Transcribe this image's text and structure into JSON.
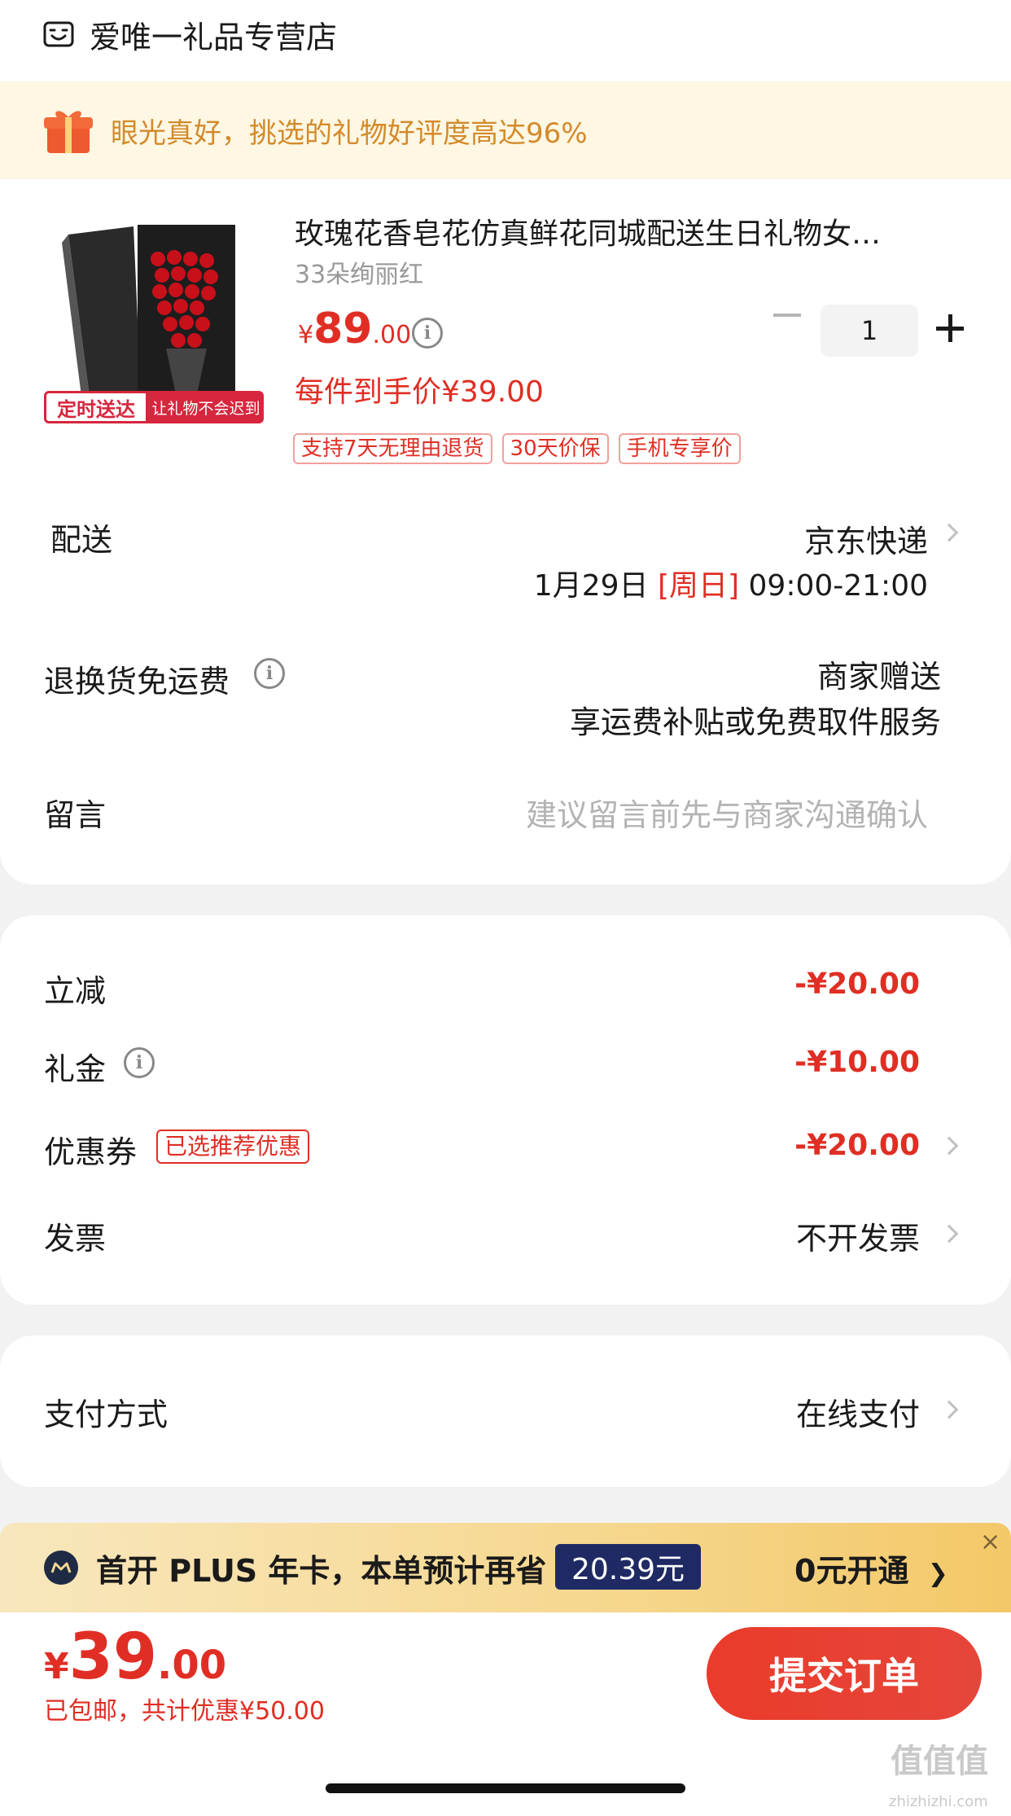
{
  "store": {
    "name": "爱唯一礼品专营店"
  },
  "gift_banner": {
    "text": "眼光真好，挑选的礼物好评度高达96%"
  },
  "product": {
    "image_badge": "定时送达",
    "image_badge_sub": "让礼物不会迟到",
    "title": "玫瑰花香皂花仿真鲜花同城配送生日礼物女…",
    "spec": "33朵绚丽红",
    "price_symbol": "¥",
    "price_int": "89",
    "price_dec": ".00",
    "quantity": "1",
    "hand_price": "每件到手价¥39.00",
    "tags": [
      "支持7天无理由退货",
      "30天价保",
      "手机专享价"
    ]
  },
  "delivery": {
    "label": "配送",
    "carrier": "京东快递",
    "date": "1月29日",
    "weekday": "[周日]",
    "time": "09:00-21:00"
  },
  "return_shipping": {
    "label": "退换货免运费",
    "value": "商家赠送",
    "desc": "享运费补贴或免费取件服务"
  },
  "message": {
    "label": "留言",
    "placeholder": "建议留言前先与商家沟通确认"
  },
  "discounts": {
    "instant": {
      "label": "立减",
      "value": "-¥20.00"
    },
    "gift_money": {
      "label": "礼金",
      "value": "-¥10.00"
    },
    "coupon": {
      "label": "优惠券",
      "tag": "已选推荐优惠",
      "value": "-¥20.00"
    },
    "invoice": {
      "label": "发票",
      "value": "不开发票"
    }
  },
  "payment": {
    "label": "支付方式",
    "value": "在线支付"
  },
  "plus_banner": {
    "text": "首开 PLUS 年卡，本单预计再省",
    "amount": "20.39元",
    "action": "0元开通",
    "close": "×"
  },
  "bottom": {
    "total_symbol": "¥",
    "total_int": "39",
    "total_dec": ".00",
    "sub": "已包邮，共计优惠¥50.00",
    "submit": "提交订单"
  },
  "watermark": {
    "text": "值值值",
    "url": "zhizhizhi.com"
  },
  "colors": {
    "accent": "#e02e24",
    "gift_text": "#d48a2a",
    "plus_dark": "#1f2a64"
  }
}
